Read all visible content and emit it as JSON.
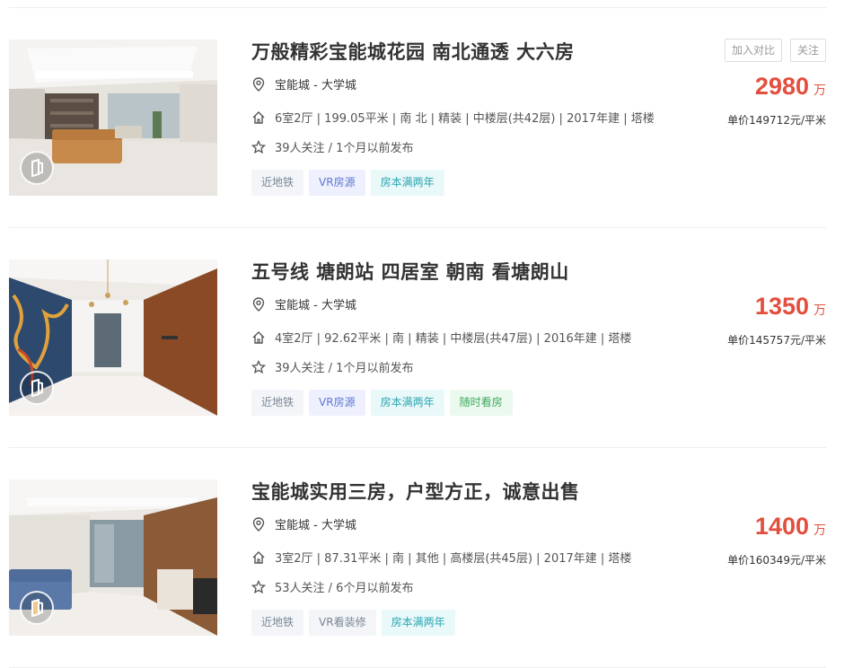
{
  "listings": [
    {
      "title": "万般精彩宝能城花园 南北通透 大六房",
      "location": "宝能城 - 大学城",
      "house_info": "6室2厅 | 199.05平米 | 南 北 | 精装 | 中楼层(共42层) | 2017年建 | 塔楼",
      "follow_info": "39人关注 / 1个月以前发布",
      "tags": [
        "近地铁",
        "VR房源",
        "房本满两年"
      ],
      "actions": [
        "加入对比",
        "关注"
      ],
      "total_price": "2980",
      "price_unit_label": "万",
      "unit_price": "单价149712元/平米"
    },
    {
      "title": "五号线 塘朗站 四居室 朝南 看塘朗山",
      "location": "宝能城 - 大学城",
      "house_info": "4室2厅 | 92.62平米 | 南 | 精装 | 中楼层(共47层) | 2016年建 | 塔楼",
      "follow_info": "39人关注 / 1个月以前发布",
      "tags": [
        "近地铁",
        "VR房源",
        "房本满两年",
        "随时看房"
      ],
      "total_price": "1350",
      "price_unit_label": "万",
      "unit_price": "单价145757元/平米"
    },
    {
      "title": "宝能城实用三房，户型方正，诚意出售",
      "location": "宝能城 - 大学城",
      "house_info": "3室2厅 | 87.31平米 | 南 | 其他 | 高楼层(共45层) | 2017年建 | 塔楼",
      "follow_info": "53人关注 / 6个月以前发布",
      "tags": [
        "近地铁",
        "VR看装修",
        "房本满两年"
      ],
      "total_price": "1400",
      "price_unit_label": "万",
      "unit_price": "单价160349元/平米"
    }
  ],
  "icons": {
    "location": "location-pin-icon",
    "house": "house-icon",
    "follow": "star-icon",
    "vr": "vr-badge-icon"
  },
  "colors": {
    "price": "#e34f3e",
    "tag_vr": "#5e77d4",
    "tag_twoyears": "#2aa6b3",
    "tag_anytime": "#3ea95c"
  }
}
